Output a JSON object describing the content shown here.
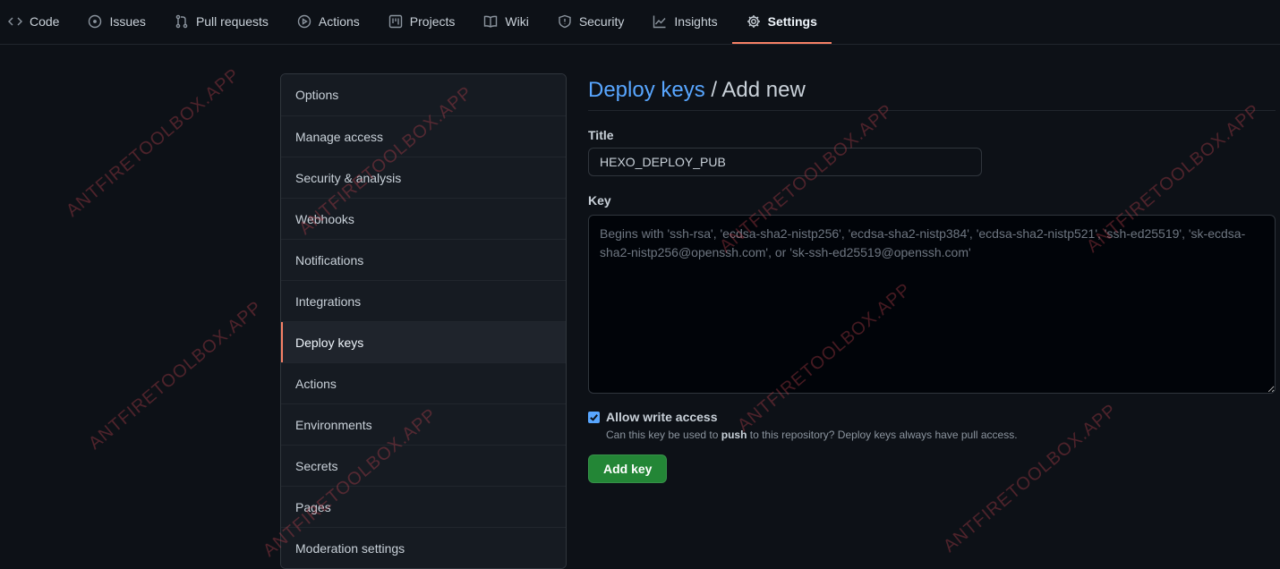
{
  "tabs": [
    {
      "label": "Code",
      "icon": "code-icon"
    },
    {
      "label": "Issues",
      "icon": "issue-icon"
    },
    {
      "label": "Pull requests",
      "icon": "pull-request-icon"
    },
    {
      "label": "Actions",
      "icon": "play-icon"
    },
    {
      "label": "Projects",
      "icon": "project-icon"
    },
    {
      "label": "Wiki",
      "icon": "book-icon"
    },
    {
      "label": "Security",
      "icon": "shield-icon"
    },
    {
      "label": "Insights",
      "icon": "graph-icon"
    },
    {
      "label": "Settings",
      "icon": "gear-icon"
    }
  ],
  "active_tab": "Settings",
  "sidebar": {
    "items": [
      {
        "label": "Options"
      },
      {
        "label": "Manage access"
      },
      {
        "label": "Security & analysis"
      },
      {
        "label": "Webhooks"
      },
      {
        "label": "Notifications"
      },
      {
        "label": "Integrations"
      },
      {
        "label": "Deploy keys"
      },
      {
        "label": "Actions"
      },
      {
        "label": "Environments"
      },
      {
        "label": "Secrets"
      },
      {
        "label": "Pages"
      },
      {
        "label": "Moderation settings"
      }
    ],
    "selected": "Deploy keys"
  },
  "main": {
    "title_link": "Deploy keys",
    "title_rest": " / Add new",
    "title_label": "Title",
    "title_value": "HEXO_DEPLOY_PUB",
    "key_label": "Key",
    "key_placeholder": "Begins with 'ssh-rsa', 'ecdsa-sha2-nistp256', 'ecdsa-sha2-nistp384', 'ecdsa-sha2-nistp521', 'ssh-ed25519', 'sk-ecdsa-sha2-nistp256@openssh.com', or 'sk-ssh-ed25519@openssh.com'",
    "allow_write_label": "Allow write access",
    "allow_write_checked": true,
    "note_before": "Can this key be used to ",
    "note_bold": "push",
    "note_after": " to this repository? Deploy keys always have pull access.",
    "add_button": "Add key"
  },
  "watermark": "ANTFIRETOOLBOX.APP",
  "colors": {
    "background": "#0d1117",
    "accent_underline": "#f78166",
    "link": "#58a6ff",
    "button_green": "#238636"
  }
}
